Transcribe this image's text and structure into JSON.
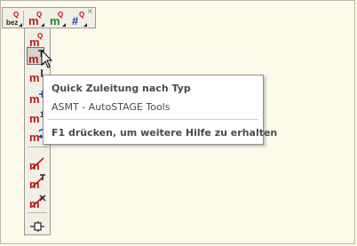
{
  "tooltip": {
    "title": "Quick Zuleitung nach Typ",
    "subtitle": "ASMT - AutoSTAGE Tools",
    "help": "F1 drücken, um weitere Hilfe zu erhalten"
  },
  "toolbar_horizontal": {
    "close_glyph": "×",
    "buttons": [
      {
        "icon": "bez-label-icon",
        "label": "bez"
      },
      {
        "icon": "m-q-icon",
        "label": "m"
      },
      {
        "icon": "m-q-green-icon",
        "label": "m"
      },
      {
        "icon": "hash-q-icon",
        "label": "#"
      }
    ]
  },
  "toolbar_vertical": {
    "buttons": [
      {
        "icon": "m-q-icon",
        "label": "m"
      },
      {
        "icon": "m-t-icon",
        "label": "m",
        "state": "pressed"
      },
      {
        "icon": "m-l-icon",
        "label": "m"
      },
      {
        "icon": "m-crosshair-icon",
        "label": "m"
      },
      {
        "icon": "m-1-icon",
        "label": "m"
      },
      {
        "icon": "m-rotate-icon",
        "label": "m"
      },
      {
        "icon": "m-strike-icon",
        "label": "m"
      },
      {
        "icon": "m-strike-t-icon",
        "label": "m"
      },
      {
        "icon": "m-strike-x-icon",
        "label": "m"
      },
      {
        "icon": "connector-icon",
        "label": ""
      }
    ]
  },
  "colors": {
    "background": "#fdfaea",
    "toolbar": "#f1efe6",
    "icon_red": "#c01515",
    "icon_green": "#1a8a2a",
    "icon_blue": "#1d3fb8"
  }
}
